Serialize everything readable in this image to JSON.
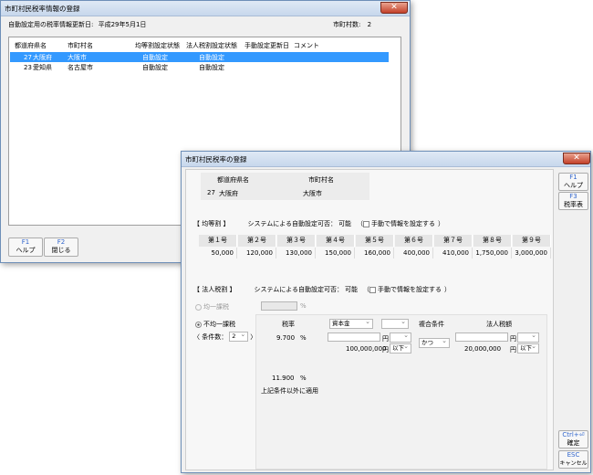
{
  "back_window": {
    "title": "市町村民税率情報の登録",
    "info_label": "自動設定用の税率情報更新日:",
    "info_date": "平成29年5月1日",
    "count_label": "市町村数:",
    "count_value": "2",
    "columns": [
      "都道府県名",
      "市町村名",
      "均等割設定状態",
      "法人税割設定状態",
      "手動設定更新日",
      "コメント"
    ],
    "rows": [
      {
        "pref_code": "27",
        "pref": "大阪府",
        "city": "大阪市",
        "kinto": "自動設定",
        "hojin": "自動設定",
        "manual": "",
        "comment": ""
      },
      {
        "pref_code": "23",
        "pref": "愛知県",
        "city": "名古屋市",
        "kinto": "自動設定",
        "hojin": "自動設定",
        "manual": "",
        "comment": ""
      }
    ],
    "buttons": [
      {
        "key": "F1",
        "label": "ヘルプ"
      },
      {
        "key": "F2",
        "label": "閉じる"
      }
    ]
  },
  "front_window": {
    "title": "市町村民税率の登録",
    "pref_header": "都道府県名",
    "city_header": "市町村名",
    "pref_code": "27",
    "pref_name": "大阪府",
    "city_name": "大阪市",
    "kinto": {
      "label": "【 均等割 】",
      "auto_label": "システムによる自動設定可否：",
      "auto_value": "可能",
      "manual_check": "手動で情報を設定する",
      "headers": [
        "第１号",
        "第２号",
        "第３号",
        "第４号",
        "第５号",
        "第６号",
        "第７号",
        "第８号",
        "第９号"
      ],
      "values": [
        "50,000",
        "120,000",
        "130,000",
        "150,000",
        "160,000",
        "400,000",
        "410,000",
        "1,750,000",
        "3,000,000"
      ]
    },
    "hojin": {
      "label": "【 法人税割 】",
      "auto_label": "システムによる自動設定可否：",
      "auto_value": "可能",
      "manual_check": "手動で情報を設定する",
      "radio_uniform": "均一課税",
      "percent": "%",
      "radio_nonuniform": "不均一課税",
      "cond_count_label": "〈 条件数：",
      "cond_count_value": "2",
      "cond_close": "〉",
      "tax_rate_header": "税率",
      "capital_select": "資本金",
      "compound_header": "複合条件",
      "tax_amount_header": "法人税額",
      "row1_rate": "9.700",
      "row1_capital": "100,000,000",
      "yen": "円",
      "row1_cap_cmp": "以下",
      "row1_compound": "かつ",
      "row1_amount": "20,000,000",
      "row1_amt_cmp": "以下",
      "row2_rate": "11.900",
      "otherwise": "上記条件以外に適用"
    },
    "side_buttons": [
      {
        "key": "F1",
        "label": "ヘルプ"
      },
      {
        "key": "F3",
        "label": "税率表"
      },
      {
        "key": "Ctrl+",
        "label": "確定"
      },
      {
        "key": "ESC",
        "label": "キャンセル"
      }
    ]
  }
}
